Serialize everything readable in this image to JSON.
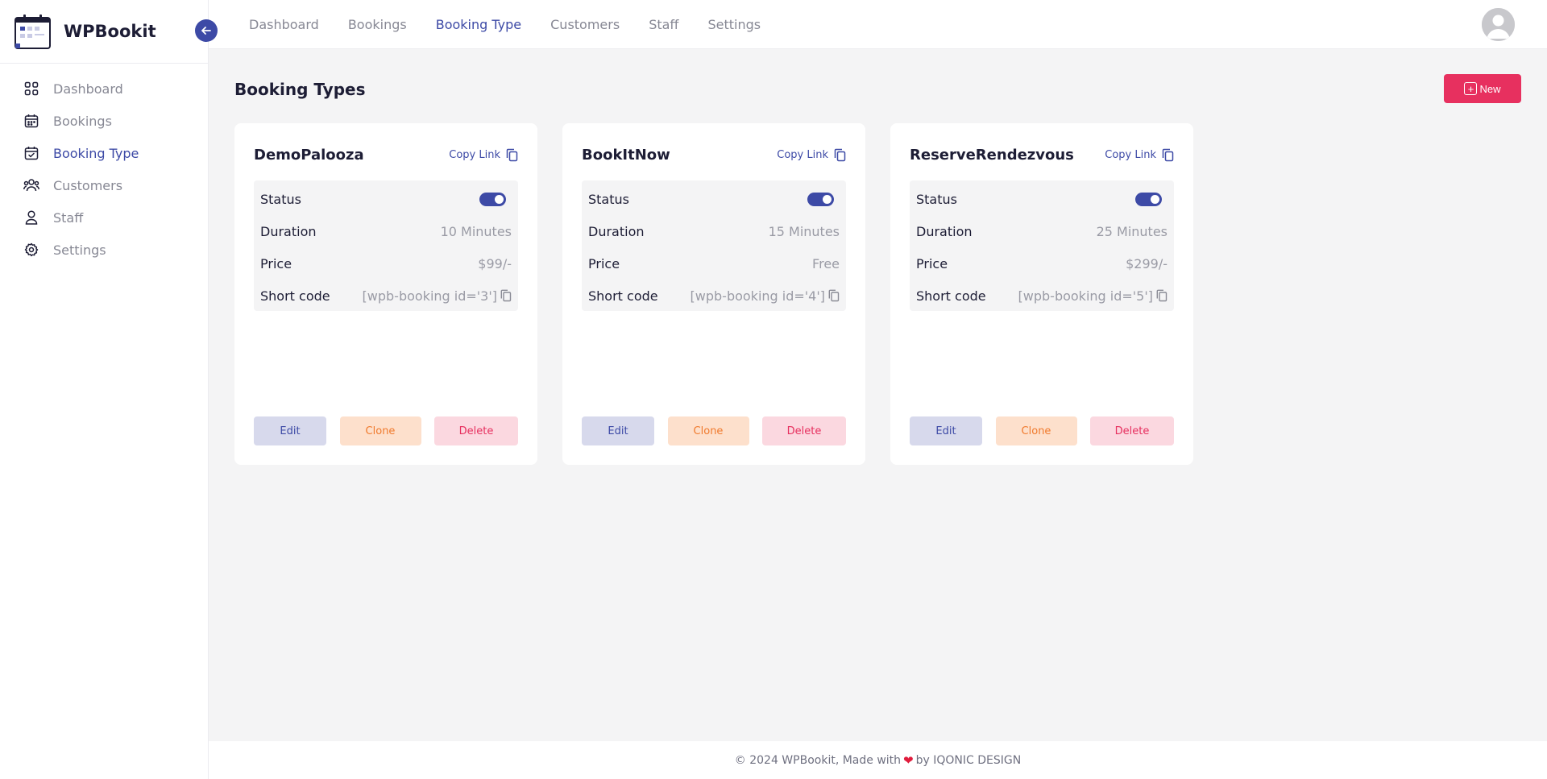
{
  "app": {
    "name": "WPBookit"
  },
  "sidebar": {
    "items": [
      {
        "label": "Dashboard",
        "icon": "grid-icon",
        "active": false
      },
      {
        "label": "Bookings",
        "icon": "calendar-icon",
        "active": false
      },
      {
        "label": "Booking Type",
        "icon": "calendar-check-icon",
        "active": true
      },
      {
        "label": "Customers",
        "icon": "users-icon",
        "active": false
      },
      {
        "label": "Staff",
        "icon": "user-icon",
        "active": false
      },
      {
        "label": "Settings",
        "icon": "gear-icon",
        "active": false
      }
    ]
  },
  "topnav": {
    "items": [
      {
        "label": "Dashboard",
        "active": false
      },
      {
        "label": "Bookings",
        "active": false
      },
      {
        "label": "Booking Type",
        "active": true
      },
      {
        "label": "Customers",
        "active": false
      },
      {
        "label": "Staff",
        "active": false
      },
      {
        "label": "Settings",
        "active": false
      }
    ]
  },
  "main": {
    "title": "Booking Types",
    "new_label": "New",
    "labels": {
      "copy_link": "Copy Link",
      "status": "Status",
      "duration": "Duration",
      "price": "Price",
      "short_code": "Short code"
    },
    "buttons": {
      "edit": "Edit",
      "clone": "Clone",
      "delete": "Delete"
    },
    "cards": [
      {
        "name": "DemoPalooza",
        "status": true,
        "duration": "10 Minutes",
        "price": "$99/-",
        "shortcode": "[wpb-booking id='3']"
      },
      {
        "name": "BookItNow",
        "status": true,
        "duration": "15 Minutes",
        "price": "Free",
        "shortcode": "[wpb-booking id='4']"
      },
      {
        "name": "ReserveRendezvous",
        "status": true,
        "duration": "25 Minutes",
        "price": "$299/-",
        "shortcode": "[wpb-booking id='5']"
      }
    ]
  },
  "footer": {
    "before": "© 2024 WPBookit, Made with",
    "after": "by IQONIC DESIGN"
  },
  "colors": {
    "primary": "#3d4aa6",
    "danger": "#e7305f",
    "warning": "#f07a2d"
  }
}
